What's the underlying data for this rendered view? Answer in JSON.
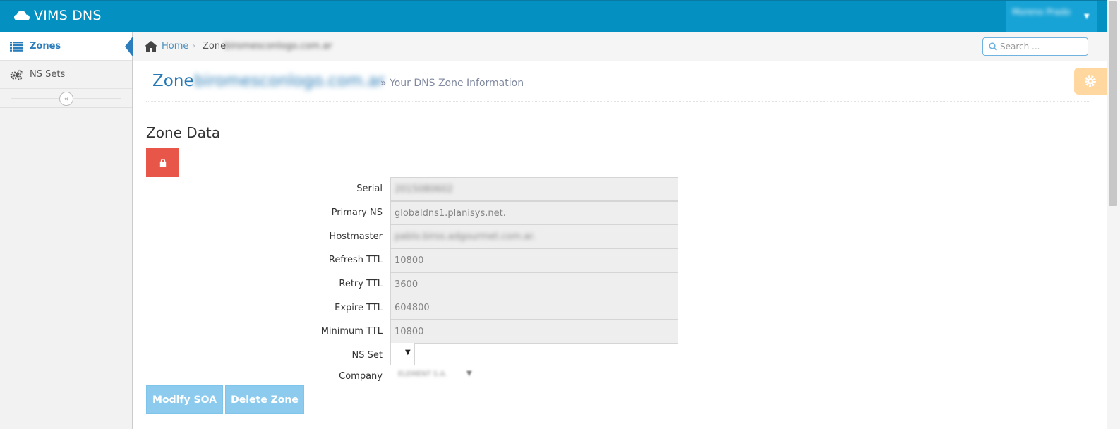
{
  "app": {
    "brand": "VIMS DNS",
    "user_name": "Moreno Prado"
  },
  "sidebar": {
    "items": [
      {
        "label": "Zones",
        "icon": "list-icon",
        "active": true
      },
      {
        "label": "NS Sets",
        "icon": "gears-icon",
        "active": false
      }
    ],
    "collapse_glyph": "«"
  },
  "breadcrumb": {
    "home": "Home",
    "separator": "›",
    "zone_label": "Zone",
    "zone_name": "biromesconlogo.com.ar"
  },
  "search": {
    "placeholder": "Search ..."
  },
  "page_header": {
    "title": "Zone",
    "zone_name": "biromesconlogo.com.ar",
    "subtitle": "» Your DNS Zone Information"
  },
  "section": {
    "title": "Zone Data"
  },
  "form": {
    "serial": {
      "label": "Serial",
      "value": "2015080602"
    },
    "primary_ns": {
      "label": "Primary NS",
      "value": "globaldns1.planisys.net."
    },
    "hostmaster": {
      "label": "Hostmaster",
      "value": "pablo.biros.adgourmet.com.ar."
    },
    "refresh_ttl": {
      "label": "Refresh TTL",
      "value": "10800"
    },
    "retry_ttl": {
      "label": "Retry TTL",
      "value": "3600"
    },
    "expire_ttl": {
      "label": "Expire TTL",
      "value": "604800"
    },
    "minimum_ttl": {
      "label": "Minimum TTL",
      "value": "10800"
    },
    "ns_set": {
      "label": "NS Set",
      "caret": "▼"
    },
    "company": {
      "label": "Company",
      "value": "ELEMENT S.A.",
      "caret": "▼"
    }
  },
  "buttons": {
    "modify_soa": "Modify SOA",
    "delete_zone": "Delete Zone"
  },
  "colors": {
    "navbar": "#0490c0",
    "accent": "#2679b5",
    "danger": "#e8564a",
    "primary_light": "#8ccbee",
    "warning": "#ffb752"
  }
}
